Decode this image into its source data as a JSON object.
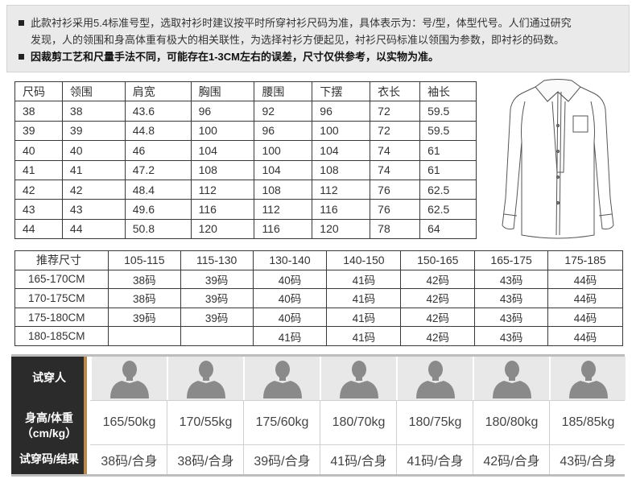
{
  "notice": {
    "line1": "此款衬衫采用5.4标准号型，选取衬衫时建议按平时所穿衬衫尺码为准，具体表示为：号/型，体型代号。人们通过研究",
    "line2": "发现，人的领围和身高体重有极大的相关联性，为选择衬衫方便起见，衬衫尺码标准以领围为参数，即衬衫的码数。",
    "line3": "因裁剪工艺和尺量手法不同，可能存在1-3CM左右的误差，尺寸仅供参考，以实物为准。"
  },
  "size_table": {
    "headers": [
      "尺码",
      "领围",
      "肩宽",
      "胸围",
      "腰围",
      "下摆",
      "衣长",
      "袖长"
    ],
    "rows": [
      [
        "38",
        "38",
        "43.6",
        "96",
        "92",
        "96",
        "72",
        "59.5"
      ],
      [
        "39",
        "39",
        "44.8",
        "100",
        "96",
        "100",
        "72",
        "59.5"
      ],
      [
        "40",
        "40",
        "46",
        "104",
        "100",
        "104",
        "74",
        "61"
      ],
      [
        "41",
        "41",
        "47.2",
        "108",
        "104",
        "108",
        "74",
        "61"
      ],
      [
        "42",
        "42",
        "48.4",
        "112",
        "108",
        "112",
        "76",
        "62.5"
      ],
      [
        "43",
        "43",
        "49.6",
        "116",
        "112",
        "116",
        "76",
        "62.5"
      ],
      [
        "44",
        "44",
        "50.8",
        "120",
        "116",
        "120",
        "78",
        "64"
      ]
    ]
  },
  "recommend_table": {
    "headers": [
      "推荐尺寸",
      "105-115",
      "115-130",
      "130-140",
      "140-150",
      "150-165",
      "165-175",
      "175-185"
    ],
    "rows": [
      [
        "165-170CM",
        "38码",
        "39码",
        "40码",
        "41码",
        "42码",
        "43码",
        "44码"
      ],
      [
        "170-175CM",
        "38码",
        "39码",
        "40码",
        "41码",
        "42码",
        "43码",
        "44码"
      ],
      [
        "175-180CM",
        "39码",
        "39码",
        "40码",
        "41码",
        "42码",
        "43码",
        "44码"
      ],
      [
        "180-185CM",
        "",
        "",
        "41码",
        "41码",
        "42码",
        "43码",
        "44码"
      ]
    ]
  },
  "fit_trial": {
    "label_person": "试穿人",
    "label_hw_line1": "身高/体重",
    "label_hw_line2": "（cm/kg）",
    "label_result": "试穿码/结果",
    "height_weight": [
      "165/50kg",
      "170/55kg",
      "175/60kg",
      "180/70kg",
      "180/75kg",
      "180/80kg",
      "185/85kg"
    ],
    "results": [
      "38码/合身",
      "38码/合身",
      "39码/合身",
      "41码/合身",
      "41码/合身",
      "42码/合身",
      "43码/合身"
    ],
    "avatar_icon": "person-silhouette-icon",
    "colors": {
      "label_bg": "#2b2b2b",
      "accent": "#b88a4e",
      "avatar_bg": "#e8e8e8",
      "silhouette": "#8a8a8a"
    }
  },
  "shirt_icon": "shirt-illustration-icon"
}
